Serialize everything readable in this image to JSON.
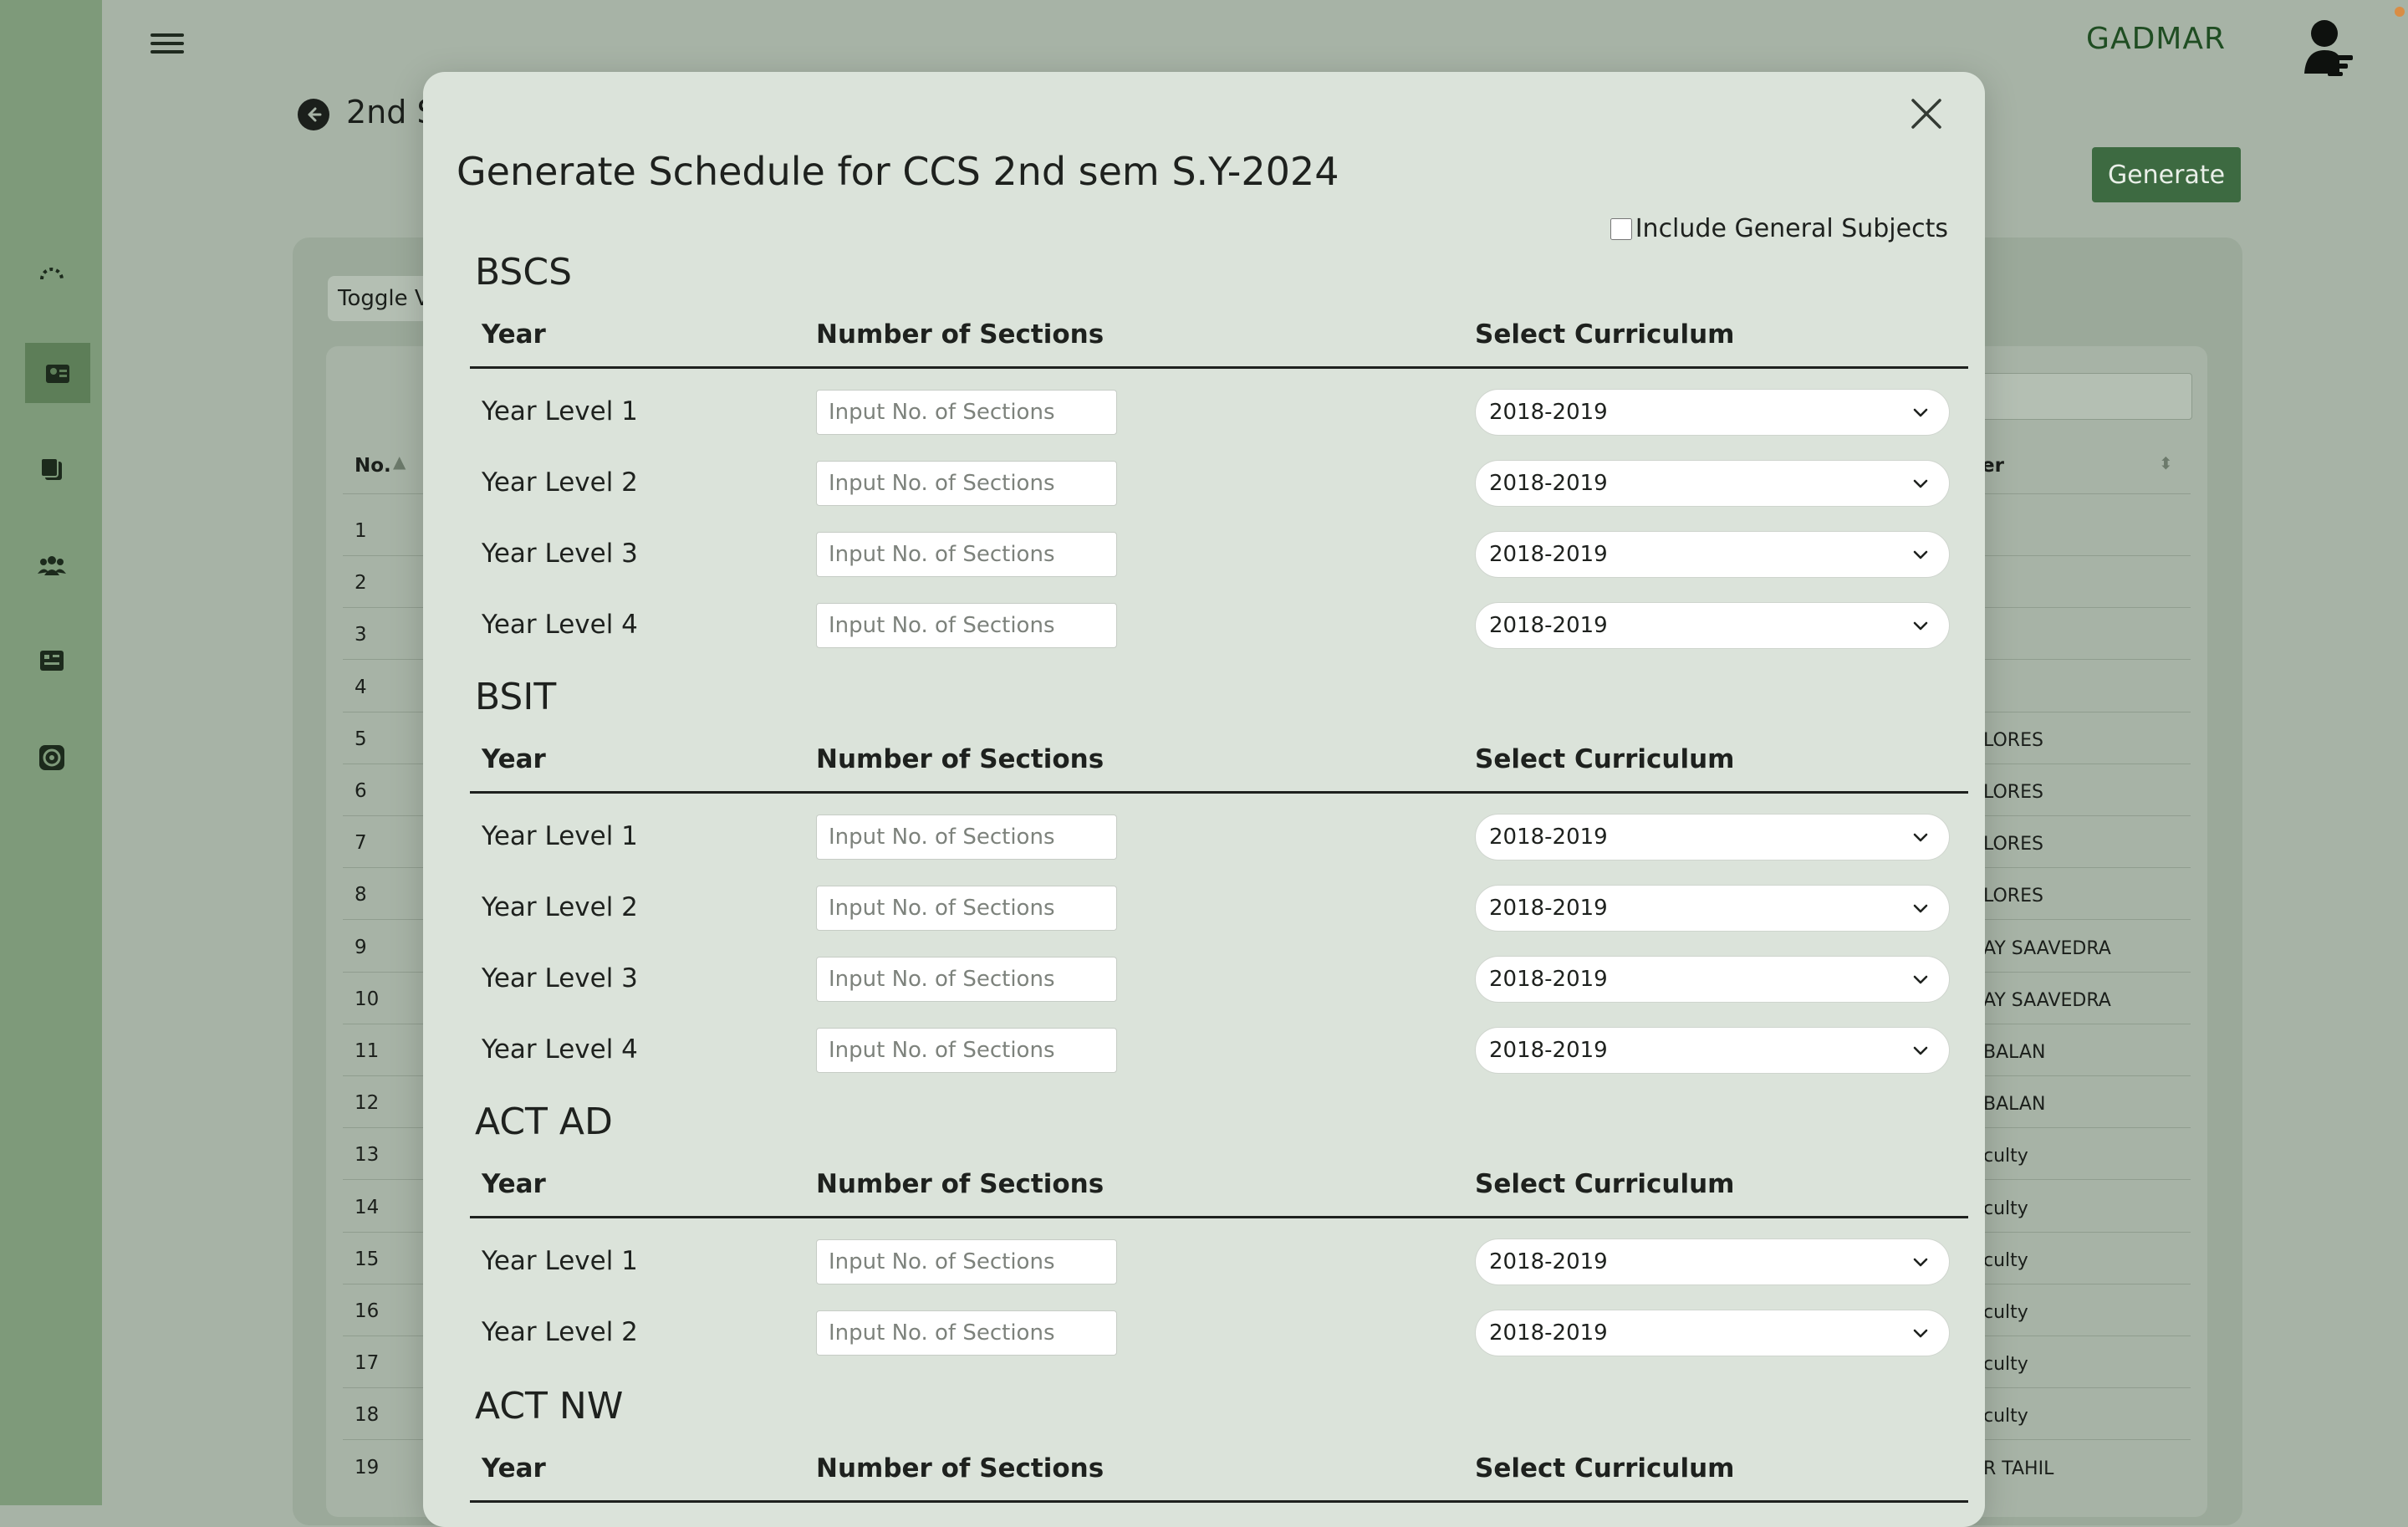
{
  "app": {
    "brand": "GADMAR",
    "page_title": "2nd S",
    "generate_label": "Generate",
    "toggle_label": "Toggle V"
  },
  "sidebar": {
    "icons": [
      "loading-icon",
      "schedule-icon",
      "files-icon",
      "users-icon",
      "rooms-icon",
      "settings-icon"
    ]
  },
  "background_table": {
    "no_header": "No.",
    "right_header": "er",
    "rows": [
      {
        "no": "1",
        "right": ""
      },
      {
        "no": "2",
        "right": ""
      },
      {
        "no": "3",
        "right": ""
      },
      {
        "no": "4",
        "right": ""
      },
      {
        "no": "5",
        "right": "LORES"
      },
      {
        "no": "6",
        "right": "LORES"
      },
      {
        "no": "7",
        "right": "LORES"
      },
      {
        "no": "8",
        "right": "LORES"
      },
      {
        "no": "9",
        "right": "AY SAAVEDRA"
      },
      {
        "no": "10",
        "right": "AY SAAVEDRA"
      },
      {
        "no": "11",
        "right": "BALAN"
      },
      {
        "no": "12",
        "right": "BALAN"
      },
      {
        "no": "13",
        "right": "culty"
      },
      {
        "no": "14",
        "right": "culty"
      },
      {
        "no": "15",
        "right": "culty"
      },
      {
        "no": "16",
        "right": "culty"
      },
      {
        "no": "17",
        "right": "culty"
      },
      {
        "no": "18",
        "right": "culty"
      },
      {
        "no": "19",
        "right": "R TAHIL"
      }
    ]
  },
  "modal": {
    "title": "Generate Schedule for CCS 2nd sem S.Y-2024",
    "include_general": "Include General Subjects",
    "col_year": "Year",
    "col_sections": "Number of Sections",
    "col_curriculum": "Select Curriculum",
    "input_placeholder": "Input No. of Sections",
    "programs": [
      {
        "name": "BSCS",
        "levels": [
          {
            "label": "Year Level 1",
            "curriculum": "2018-2019"
          },
          {
            "label": "Year Level 2",
            "curriculum": "2018-2019"
          },
          {
            "label": "Year Level 3",
            "curriculum": "2018-2019"
          },
          {
            "label": "Year Level 4",
            "curriculum": "2018-2019"
          }
        ]
      },
      {
        "name": "BSIT",
        "levels": [
          {
            "label": "Year Level 1",
            "curriculum": "2018-2019"
          },
          {
            "label": "Year Level 2",
            "curriculum": "2018-2019"
          },
          {
            "label": "Year Level 3",
            "curriculum": "2018-2019"
          },
          {
            "label": "Year Level 4",
            "curriculum": "2018-2019"
          }
        ]
      },
      {
        "name": "ACT AD",
        "levels": [
          {
            "label": "Year Level 1",
            "curriculum": "2018-2019"
          },
          {
            "label": "Year Level 2",
            "curriculum": "2018-2019"
          }
        ]
      },
      {
        "name": "ACT NW",
        "levels": []
      }
    ]
  }
}
